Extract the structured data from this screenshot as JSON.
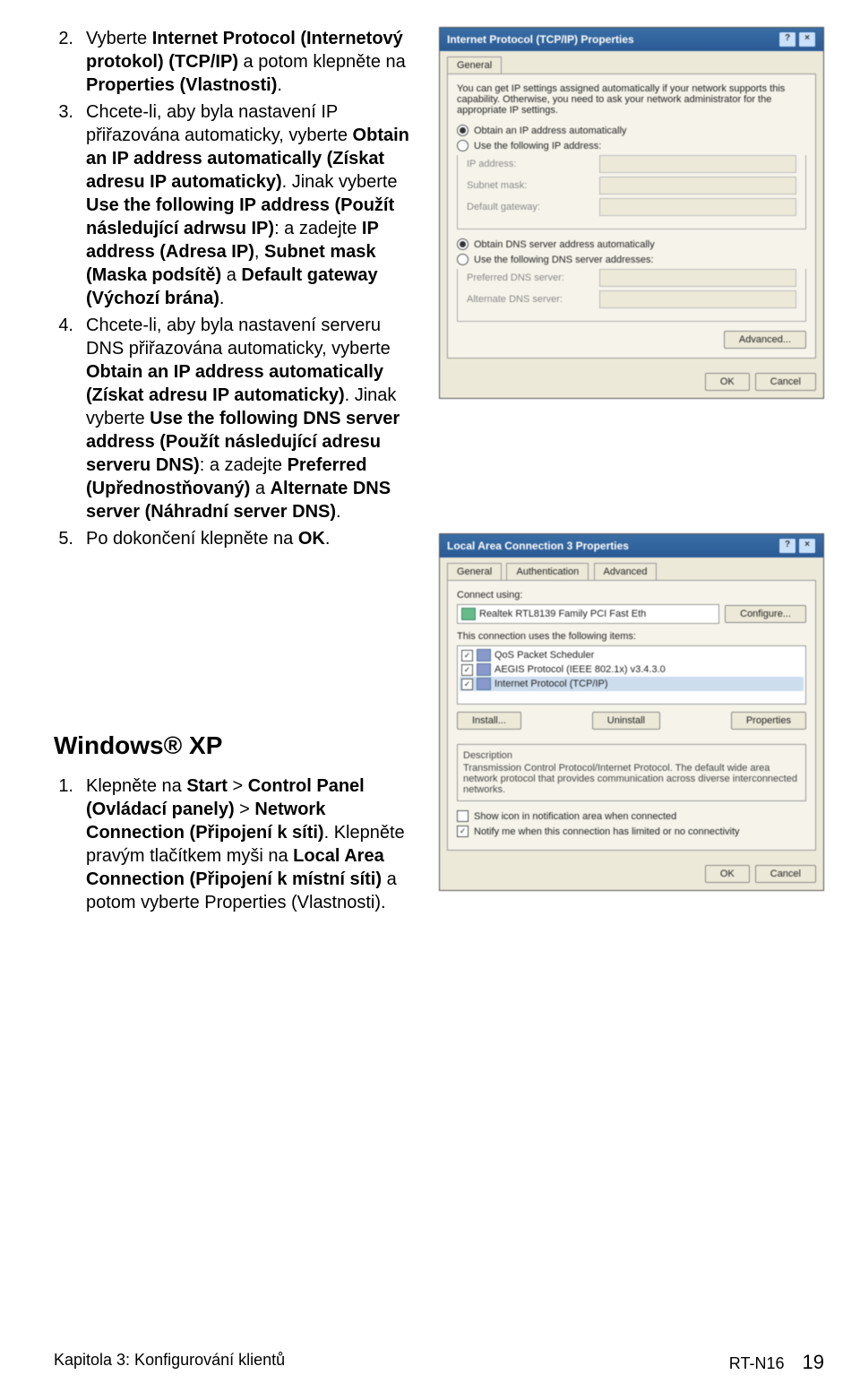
{
  "instructions": {
    "items": [
      {
        "num": "2.",
        "parts": [
          {
            "t": "Vyberte ",
            "b": false
          },
          {
            "t": "Internet Protocol (Internetový protokol) (TCP/IP)",
            "b": true
          },
          {
            "t": " a potom klepněte na ",
            "b": false
          },
          {
            "t": "Properties (Vlastnosti)",
            "b": true
          },
          {
            "t": ".",
            "b": false
          }
        ]
      },
      {
        "num": "3.",
        "parts": [
          {
            "t": "Chcete-li, aby byla nastavení IP přiřazována automaticky, vyberte ",
            "b": false
          },
          {
            "t": "Obtain an IP address automatically (Získat adresu IP automaticky)",
            "b": true
          },
          {
            "t": ". Jinak vyberte ",
            "b": false
          },
          {
            "t": "Use the following IP address (Použít následující adrwsu IP)",
            "b": true
          },
          {
            "t": ": a zadejte ",
            "b": false
          },
          {
            "t": "IP address (Adresa IP)",
            "b": true
          },
          {
            "t": ", ",
            "b": false
          },
          {
            "t": "Subnet mask (Maska podsítě)",
            "b": true
          },
          {
            "t": " a ",
            "b": false
          },
          {
            "t": "Default gateway (Výchozí brána)",
            "b": true
          },
          {
            "t": ".",
            "b": false
          }
        ]
      },
      {
        "num": "4.",
        "parts": [
          {
            "t": "Chcete-li, aby byla nastavení serveru DNS přiřazována automaticky, vyberte ",
            "b": false
          },
          {
            "t": "Obtain an IP address automatically (Získat adresu IP automaticky)",
            "b": true
          },
          {
            "t": ". Jinak vyberte ",
            "b": false
          },
          {
            "t": "Use the following DNS server address (Použít následující adresu serveru DNS)",
            "b": true
          },
          {
            "t": ": a zadejte ",
            "b": false
          },
          {
            "t": "Preferred (Upřednostňovaný)",
            "b": true
          },
          {
            "t": " a ",
            "b": false
          },
          {
            "t": "Alternate DNS server (Náhradní server DNS)",
            "b": true
          },
          {
            "t": ".",
            "b": false
          }
        ]
      },
      {
        "num": "5.",
        "parts": [
          {
            "t": "Po dokončení klepněte na ",
            "b": false
          },
          {
            "t": "OK",
            "b": true
          },
          {
            "t": ".",
            "b": false
          }
        ]
      }
    ]
  },
  "heading_xp": "Windows® XP",
  "xp_steps": {
    "items": [
      {
        "num": "1.",
        "parts": [
          {
            "t": "Klepněte na ",
            "b": false
          },
          {
            "t": "Start",
            "b": true
          },
          {
            "t": " > ",
            "b": false
          },
          {
            "t": "Control Panel (Ovládací panely)",
            "b": true
          },
          {
            "t": " > ",
            "b": false
          },
          {
            "t": "Network Connection (Připojení k síti)",
            "b": true
          },
          {
            "t": ". Klepněte pravým tlačítkem myši na ",
            "b": false
          },
          {
            "t": "Local Area Connection (Připojení k místní síti)",
            "b": true
          },
          {
            "t": " a potom vyberte Properties (Vlastnosti).",
            "b": false
          }
        ]
      }
    ]
  },
  "dialog1": {
    "title": "Internet Protocol (TCP/IP) Properties",
    "tab": "General",
    "intro": "You can get IP settings assigned automatically if your network supports this capability. Otherwise, you need to ask your network administrator for the appropriate IP settings.",
    "r_obtain_ip": "Obtain an IP address automatically",
    "r_use_ip": "Use the following IP address:",
    "ip_label": "IP address:",
    "subnet_label": "Subnet mask:",
    "gateway_label": "Default gateway:",
    "r_obtain_dns": "Obtain DNS server address automatically",
    "r_use_dns": "Use the following DNS server addresses:",
    "pref_dns": "Preferred DNS server:",
    "alt_dns": "Alternate DNS server:",
    "advanced": "Advanced...",
    "ok": "OK",
    "cancel": "Cancel"
  },
  "dialog2": {
    "title": "Local Area Connection 3 Properties",
    "tabs": [
      "General",
      "Authentication",
      "Advanced"
    ],
    "connect_using": "Connect using:",
    "nic": "Realtek RTL8139 Family PCI Fast Eth",
    "configure": "Configure...",
    "uses": "This connection uses the following items:",
    "items": [
      "QoS Packet Scheduler",
      "AEGIS Protocol (IEEE 802.1x) v3.4.3.0",
      "Internet Protocol (TCP/IP)"
    ],
    "install": "Install...",
    "uninstall": "Uninstall",
    "properties": "Properties",
    "desc_head": "Description",
    "desc_body": "Transmission Control Protocol/Internet Protocol. The default wide area network protocol that provides communication across diverse interconnected networks.",
    "chk_tray": "Show icon in notification area when connected",
    "chk_notify": "Notify me when this connection has limited or no connectivity",
    "ok": "OK",
    "cancel": "Cancel"
  },
  "footer": {
    "left": "Kapitola 3: Konfigurování klientů",
    "right_model": "RT-N16",
    "page": "19"
  }
}
